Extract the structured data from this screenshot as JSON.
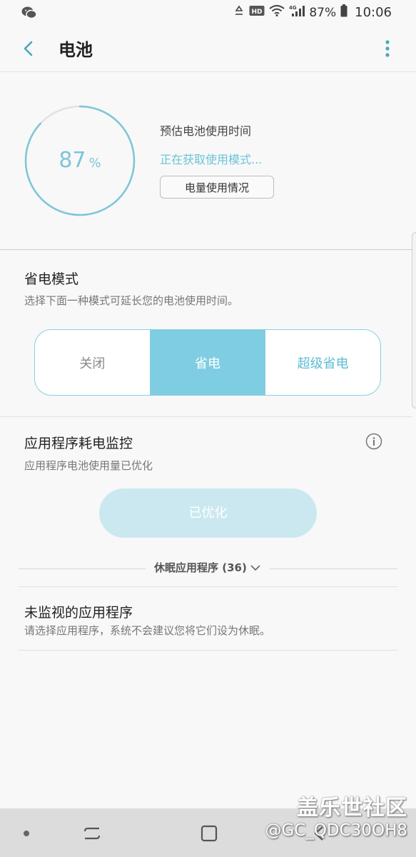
{
  "status_bar": {
    "left_icon": "wechat-icon",
    "icons": [
      "recycle-icon",
      "hd-icon",
      "wifi-icon",
      "4g-signal-icon"
    ],
    "hd_label": "HD",
    "network_label": "4G",
    "battery_percent": "87%",
    "time": "10:06"
  },
  "header": {
    "title": "电池",
    "back_icon": "back-arrow-icon",
    "more_icon": "more-vertical-icon"
  },
  "battery": {
    "level_value": "87",
    "level_unit": "%",
    "level_fraction": 0.87,
    "estimate_label": "预估电池使用时间",
    "estimate_status": "正在获取使用模式...",
    "usage_button": "电量使用情况",
    "ring_color": "#7cc6d8"
  },
  "power_saving": {
    "title": "省电模式",
    "description": "选择下面一种模式可延长您的电池使用时间。",
    "modes": [
      "关闭",
      "省电",
      "超级省电"
    ],
    "selected_mode": "省电",
    "accent_color": "#7fcde2"
  },
  "app_monitor": {
    "title": "应用程序耗电监控",
    "description": "应用程序电池使用量已优化",
    "optimized_button": "已优化",
    "sleeping_apps": "休眠应用程序 (36)",
    "info_icon": "info-icon"
  },
  "unmonitored": {
    "title": "未监视的应用程序",
    "description": "请选择应用程序，系统不会建议您将它们设为休眠。"
  },
  "watermark": {
    "line1": "盖乐世社区",
    "line2": "@GC_QDC30OH8"
  },
  "nav_bar": {
    "icons": [
      "dot-icon",
      "recent-apps-icon",
      "home-icon",
      "back-icon"
    ]
  }
}
